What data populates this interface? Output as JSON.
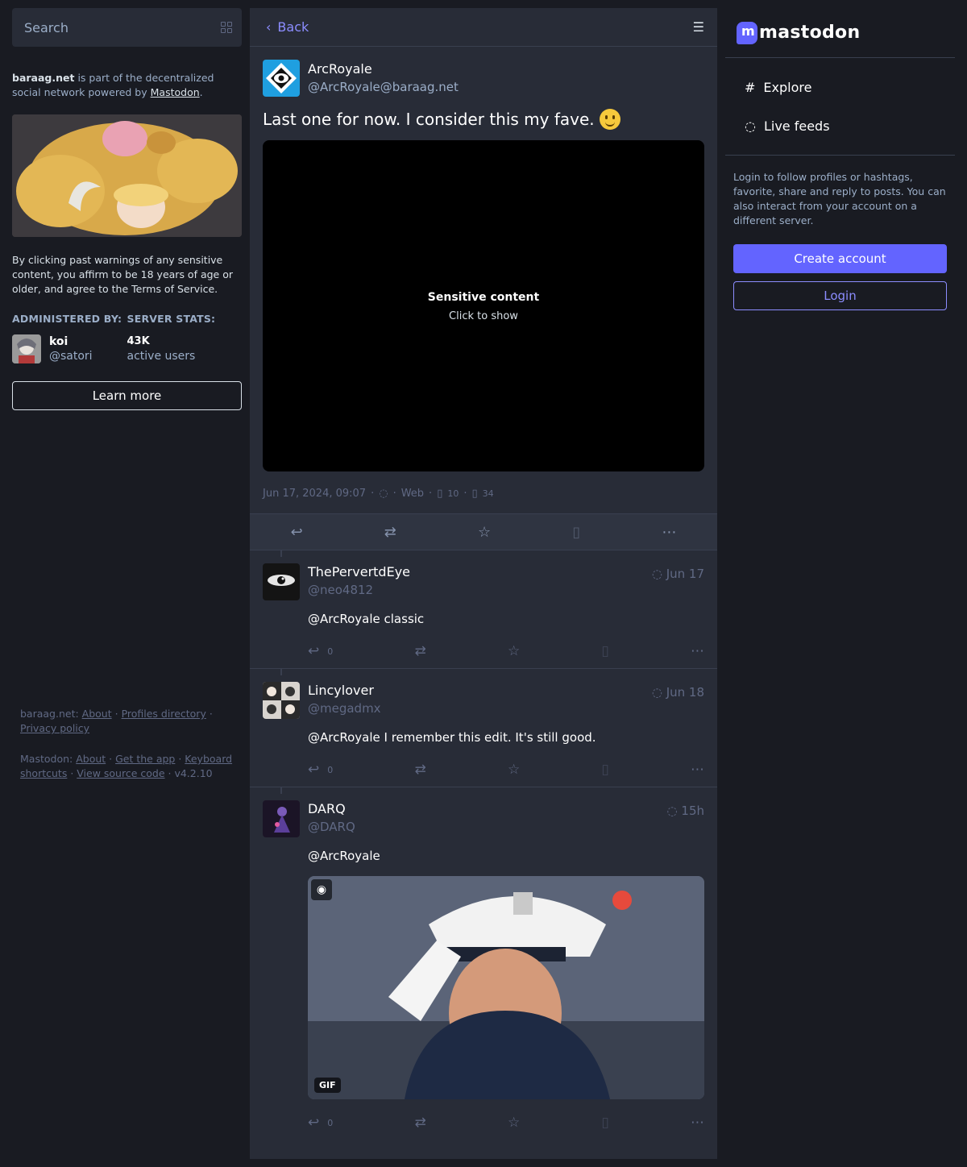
{
  "search": {
    "placeholder": "Search"
  },
  "server": {
    "domain": "baraag.net",
    "desc_mid": " is part of the decentralized social network powered by ",
    "desc_link": "Mastodon",
    "desc_end": ".",
    "disclaimer": "By clicking past warnings of any sensitive content, you affirm to be 18 years of age or older, and agree to the Terms of Service.",
    "administered_by": "ADMINISTERED BY:",
    "server_stats": "SERVER STATS:",
    "admin_name": "koi",
    "admin_handle": "@satori",
    "stat_num": "43K",
    "stat_label": "active users",
    "learn_more": "Learn more"
  },
  "footer": {
    "server_label": "baraag.net",
    "about": "About",
    "profiles": "Profiles directory",
    "privacy": "Privacy policy",
    "mastodon_label": "Mastodon",
    "about2": "About",
    "get_app": "Get the app",
    "keyboard": "Keyboard shortcuts",
    "source": "View source code",
    "version": "v4.2.10"
  },
  "header": {
    "back": "Back",
    "back_icon": "chevron-left-icon",
    "menu_icon": "menu-icon"
  },
  "main_status": {
    "display_name": "ArcRoyale",
    "account": "@ArcRoyale@baraag.net",
    "text": "Last one for now. I consider this my fave.",
    "sensitive_title": "Sensitive content",
    "sensitive_sub": "Click to show",
    "date": "Jun 17, 2024, 09:07",
    "sep": "·",
    "app": "Web",
    "boosts": "10",
    "favs": "34"
  },
  "replies": [
    {
      "display_name": "ThePervertdEye",
      "account": "@neo4812",
      "time": "Jun 17",
      "mention": "@ArcRoyale",
      "text": " classic",
      "replies": "0"
    },
    {
      "display_name": "Lincylover",
      "account": "@megadmx",
      "time": "Jun 18",
      "mention": "@ArcRoyale",
      "text": " I remember this edit. It's still good.",
      "replies": "0"
    },
    {
      "display_name": "DARQ",
      "account": "@DARQ",
      "time": "15h",
      "mention": "@ArcRoyale",
      "text": "",
      "replies": "0",
      "gif_badge": "GIF"
    }
  ],
  "right": {
    "logo": "mastodon",
    "explore": "Explore",
    "live_feeds": "Live feeds",
    "login_text": "Login to follow profiles or hashtags, favorite, share and reply to posts. You can also interact from your account on a different server.",
    "create_account": "Create account",
    "login": "Login"
  },
  "colors": {
    "accent": "#6364ff",
    "accent_light": "#8c8dff",
    "bg": "#191b22",
    "panel": "#282c37"
  }
}
